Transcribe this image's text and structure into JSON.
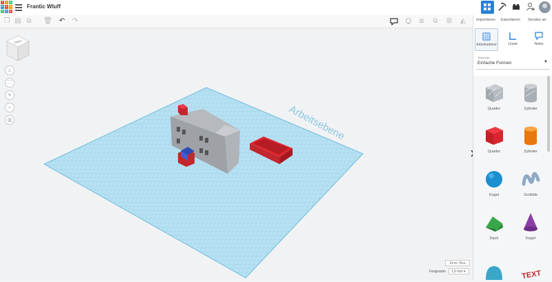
{
  "app": {
    "title": "Frantic Wluff",
    "logo_letters": [
      "T",
      "I",
      "N",
      "K",
      "E",
      "R",
      "C",
      "A",
      "D"
    ],
    "logo_colors": [
      "#e94b3c",
      "#f39c12",
      "#2ecc71",
      "#3498db",
      "#e94b3c",
      "#f39c12",
      "#2ecc71",
      "#3498db",
      "#e94b3c"
    ]
  },
  "header": {
    "icons": [
      "grid-view-icon",
      "pickaxe-icon",
      "bricks-icon",
      "add-user-icon",
      "avatar"
    ]
  },
  "toolbar": {
    "left_tools": [
      "copy-icon",
      "paste-icon",
      "duplicate-icon",
      "delete-icon",
      "undo-icon",
      "redo-icon"
    ],
    "right_tools": [
      "comment-icon",
      "light-bulb-icon",
      "group-icon",
      "ungroup-icon",
      "align-icon",
      "mirror-icon"
    ]
  },
  "panel": {
    "top_actions": [
      "Importieren",
      "Exportieren",
      "Senden an"
    ],
    "tabs": [
      {
        "label": "Arbeitsebene",
        "active": true
      },
      {
        "label": "Lineal",
        "active": false
      },
      {
        "label": "Notes",
        "active": false
      }
    ],
    "library": {
      "label": "Tinkercad",
      "value": "Einfache Formen"
    },
    "shapes": [
      {
        "name": "Quader",
        "color": "#9aa3ad"
      },
      {
        "name": "Zylinder",
        "color": "#9aa3ad"
      },
      {
        "name": "Quader",
        "color": "#d7262f"
      },
      {
        "name": "Zylinder",
        "color": "#ef7d1a"
      },
      {
        "name": "Kugel",
        "color": "#1a8fcf"
      },
      {
        "name": "Scribble",
        "color": "#8fa9c4"
      },
      {
        "name": "Dach",
        "color": "#3aa64a"
      },
      {
        "name": "Kegel",
        "color": "#8a3ea6"
      },
      {
        "name": "",
        "color": "#3aa7c9"
      },
      {
        "name": "",
        "color": "#c4262e"
      }
    ]
  },
  "workspace": {
    "plane_label": "Arbeitsebene",
    "viewcube_label": "OBEN",
    "settings_label": "Einst. Bea",
    "snap_label": "Fangraster",
    "snap_value": "1,0 mm"
  },
  "colors": {
    "accent": "#2980d6",
    "grid": "#a8d8ec",
    "grid_line": "#7cc4e0"
  }
}
